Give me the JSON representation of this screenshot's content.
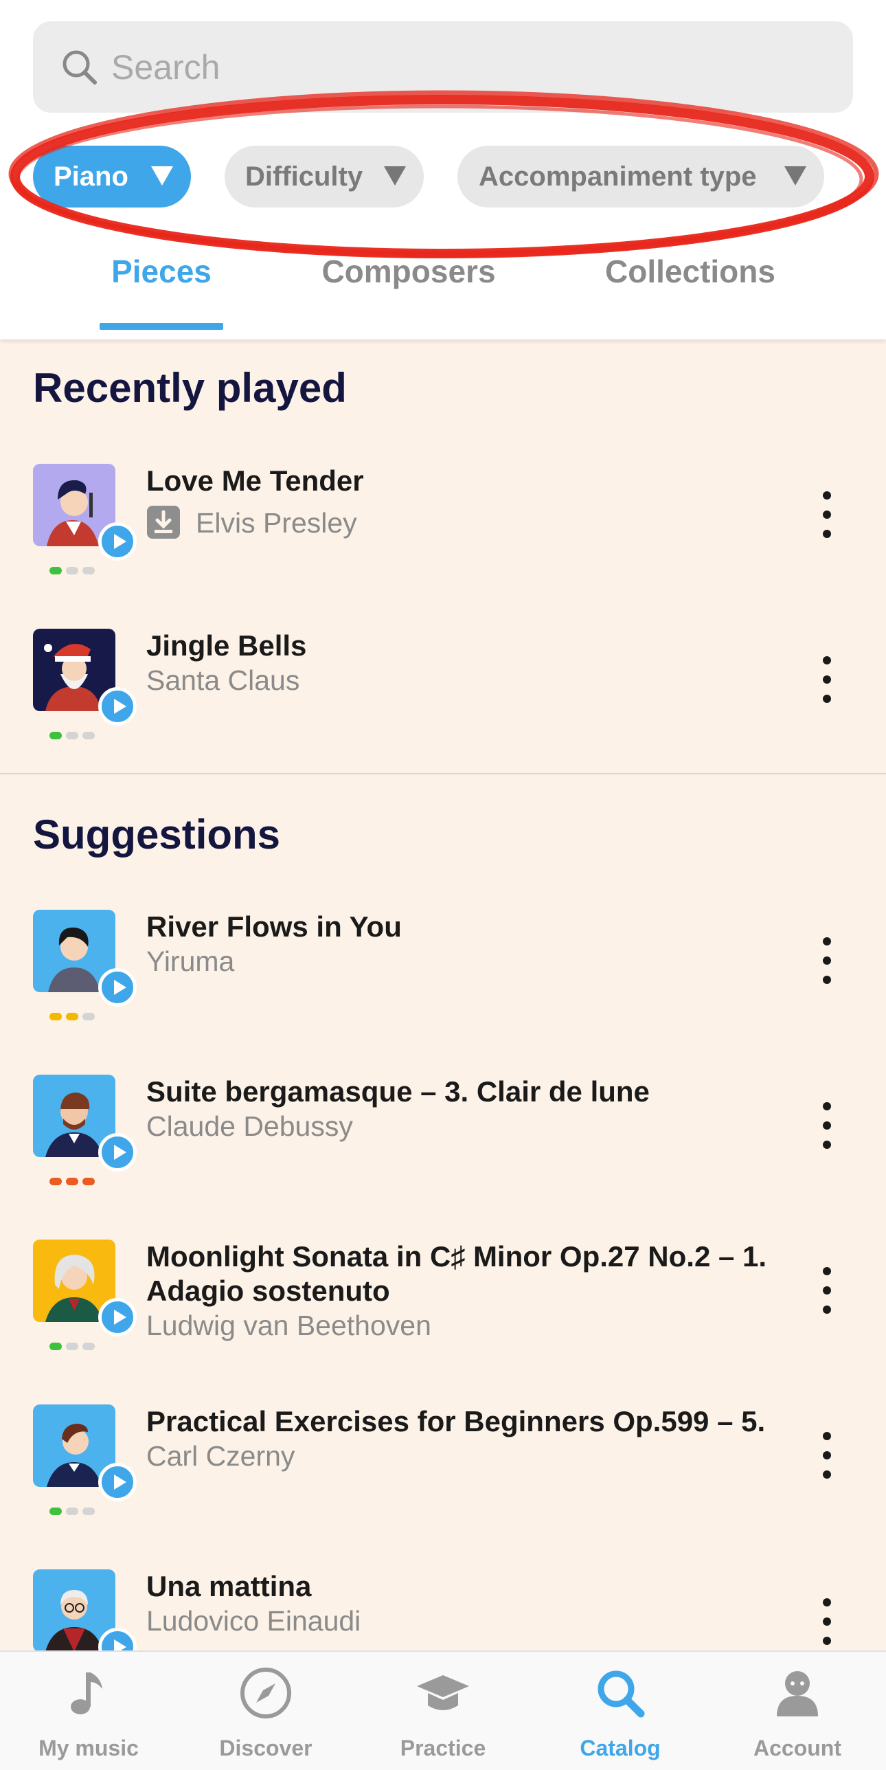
{
  "search": {
    "placeholder": "Search"
  },
  "filters": [
    {
      "label": "Piano",
      "active": true
    },
    {
      "label": "Difficulty",
      "active": false
    },
    {
      "label": "Accompaniment type",
      "active": false
    }
  ],
  "tabs": [
    {
      "label": "Pieces",
      "active": true
    },
    {
      "label": "Composers",
      "active": false
    },
    {
      "label": "Collections",
      "active": false
    }
  ],
  "recently_played": {
    "title": "Recently played",
    "items": [
      {
        "title": "Love Me Tender",
        "artist": "Elvis Presley",
        "downloaded": true,
        "difficulty": 1,
        "difficulty_color": "#3ec13e"
      },
      {
        "title": "Jingle Bells",
        "artist": "Santa Claus",
        "downloaded": false,
        "difficulty": 1,
        "difficulty_color": "#3ec13e"
      }
    ]
  },
  "suggestions": {
    "title": "Suggestions",
    "items": [
      {
        "title": "River Flows in You",
        "artist": "Yiruma",
        "difficulty": 2,
        "difficulty_color": "#f5b800"
      },
      {
        "title": "Suite bergamasque – 3. Clair de lune",
        "artist": "Claude Debussy",
        "difficulty": 3,
        "difficulty_color": "#ec5b20"
      },
      {
        "title_line1": "Moonlight Sonata in C♯ Minor Op.27 No.2 – 1.",
        "title_line2": "Adagio sostenuto",
        "artist": "Ludwig van Beethoven",
        "difficulty": 1,
        "difficulty_color": "#3ec13e"
      },
      {
        "title": "Practical Exercises for Beginners Op.599 – 5.",
        "artist": "Carl Czerny",
        "difficulty": 1,
        "difficulty_color": "#3ec13e"
      },
      {
        "title": "Una mattina",
        "artist": "Ludovico Einaudi"
      }
    ]
  },
  "nav": [
    {
      "label": "My music",
      "icon": "music-note-icon",
      "active": false
    },
    {
      "label": "Discover",
      "icon": "compass-icon",
      "active": false
    },
    {
      "label": "Practice",
      "icon": "graduation-cap-icon",
      "active": false
    },
    {
      "label": "Catalog",
      "icon": "search-icon",
      "active": true
    },
    {
      "label": "Account",
      "icon": "person-icon",
      "active": false
    }
  ],
  "colors": {
    "accent": "#3ea6e9",
    "background": "#fcf2e7",
    "annotation": "#e8271b"
  }
}
